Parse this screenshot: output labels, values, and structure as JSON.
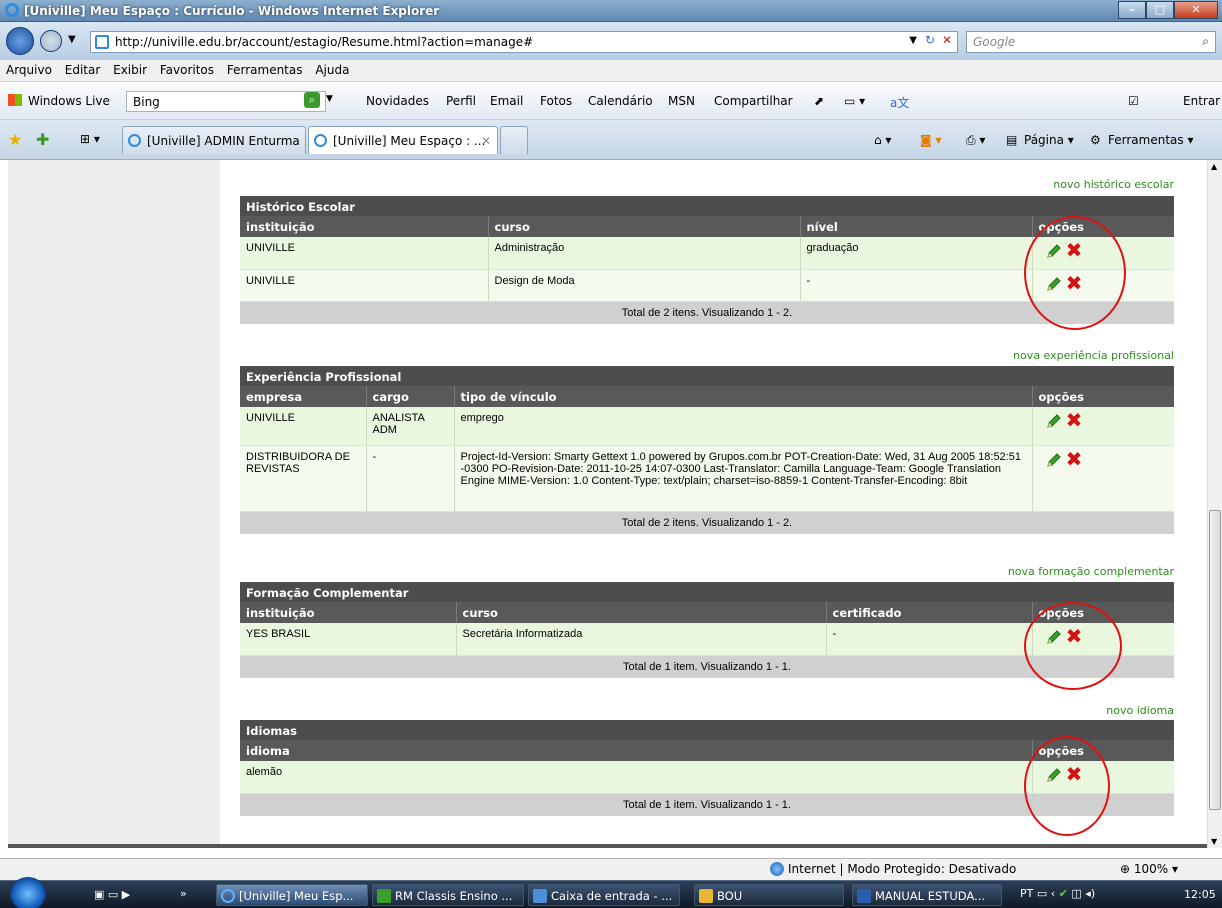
{
  "window": {
    "title": "[Univille] Meu Espaço : Currículo - Windows Internet Explorer"
  },
  "address": {
    "url": "http://univille.edu.br/account/estagio/Resume.html?action=manage#",
    "search_placeholder": "Google"
  },
  "menu": [
    "Arquivo",
    "Editar",
    "Exibir",
    "Favoritos",
    "Ferramentas",
    "Ajuda"
  ],
  "live": {
    "brand": "Windows Live",
    "search_value": "Bing",
    "links": [
      "Novidades",
      "Perfil",
      "Email",
      "Fotos",
      "Calendário",
      "MSN",
      "Compartilhar"
    ],
    "signin": "Entrar"
  },
  "tabs": [
    {
      "label": "[Univille] ADMIN Enturma ..."
    },
    {
      "label": "[Univille] Meu Espaço : ..."
    }
  ],
  "commands": {
    "page": "Página",
    "tools": "Ferramentas"
  },
  "sections": {
    "historico": {
      "link": "novo histórico escolar",
      "title": "Histórico Escolar",
      "columns": [
        "instituição",
        "curso",
        "nível",
        "opções"
      ],
      "rows": [
        [
          "UNIVILLE",
          "Administração",
          "graduação"
        ],
        [
          "UNIVILLE",
          "Design de Moda",
          "-"
        ]
      ],
      "total": "Total de 2 itens. Visualizando 1 - 2."
    },
    "experiencia": {
      "link": "nova experiência profissional",
      "title": "Experiência Profissional",
      "columns": [
        "empresa",
        "cargo",
        "tipo de vínculo",
        "opções"
      ],
      "rows": [
        [
          "UNIVILLE",
          "ANALISTA ADM",
          "emprego"
        ],
        [
          "DISTRIBUIDORA DE REVISTAS",
          "-",
          "Project-Id-Version: Smarty Gettext 1.0 powered by Grupos.com.br POT-Creation-Date: Wed, 31 Aug 2005 18:52:51 -0300 PO-Revision-Date: 2011-10-25 14:07-0300 Last-Translator: Camilla Language-Team: Google Translation Engine MIME-Version: 1.0 Content-Type: text/plain; charset=iso-8859-1 Content-Transfer-Encoding: 8bit"
        ]
      ],
      "total": "Total de 2 itens. Visualizando 1 - 2."
    },
    "formacao": {
      "link": "nova formação complementar",
      "title": "Formação Complementar",
      "columns": [
        "instituição",
        "curso",
        "certificado",
        "opções"
      ],
      "rows": [
        [
          "YES BRASIL",
          "Secretária Informatizada",
          "-"
        ]
      ],
      "total": "Total de 1 item. Visualizando 1 - 1."
    },
    "idiomas": {
      "link": "novo idioma",
      "title": "Idiomas",
      "columns": [
        "idioma",
        "opções"
      ],
      "rows": [
        [
          "alemão"
        ]
      ],
      "total": "Total de 1 item. Visualizando 1 - 1."
    }
  },
  "status": {
    "zone": "Internet | Modo Protegido: Desativado",
    "zoom": "100%"
  },
  "taskbar": {
    "items": [
      "[Univille] Meu Esp...",
      "RM Classis Ensino ...",
      "Caixa de entrada - ...",
      "BOU",
      "MANUAL ESTUDA..."
    ],
    "lang": "PT",
    "time": "12:05"
  },
  "colors": {
    "link_green": "#2a8f1a",
    "header_dark": "#4d4d4d",
    "row_green": "#eaf7df",
    "annotation_red": "#e01010"
  }
}
